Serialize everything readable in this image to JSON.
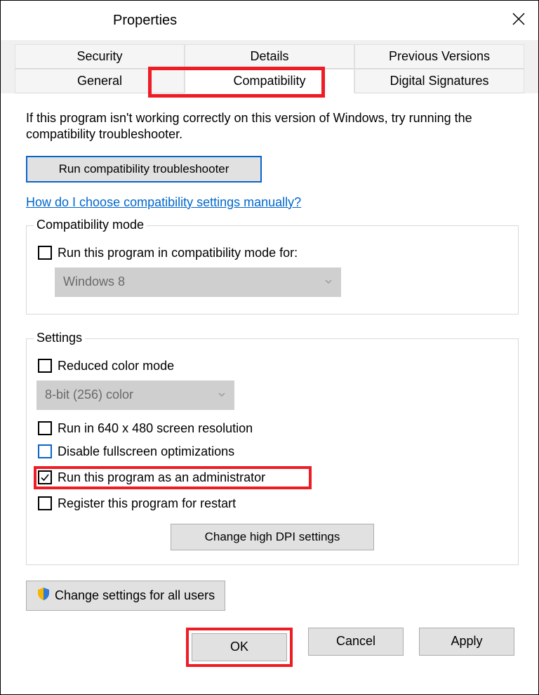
{
  "titlebar": {
    "title": "Properties"
  },
  "tabs": {
    "row1": [
      "Security",
      "Details",
      "Previous Versions"
    ],
    "row2": [
      "General",
      "Compatibility",
      "Digital Signatures"
    ],
    "active": "Compatibility"
  },
  "intro": "If this program isn't working correctly on this version of Windows, try running the compatibility troubleshooter.",
  "run_troubleshooter": "Run compatibility troubleshooter",
  "manual_link": "How do I choose compatibility settings manually?",
  "compat_mode": {
    "legend": "Compatibility mode",
    "checkbox": "Run this program in compatibility mode for:",
    "select": "Windows 8"
  },
  "settings": {
    "legend": "Settings",
    "reduced_color": "Reduced color mode",
    "color_select": "8-bit (256) color",
    "resolution": "Run in 640 x 480 screen resolution",
    "fullscreen": "Disable fullscreen optimizations",
    "admin": "Run this program as an administrator",
    "restart": "Register this program for restart",
    "dpi_btn": "Change high DPI settings"
  },
  "all_users_btn": "Change settings for all users",
  "buttons": {
    "ok": "OK",
    "cancel": "Cancel",
    "apply": "Apply"
  }
}
